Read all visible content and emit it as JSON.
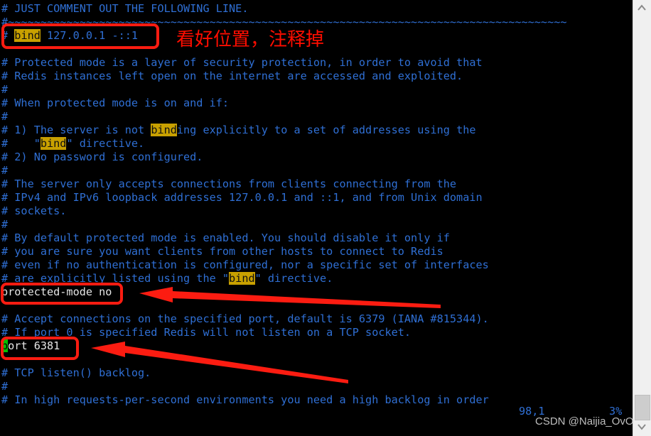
{
  "app": {
    "type": "terminal-text-editor",
    "filename_context": "redis.conf",
    "background_color": "#000000",
    "comment_color": "#2f6fd4",
    "text_color": "#e6e6e6",
    "search_highlight_color": "#c8a000",
    "cursor_color": "#00c000",
    "annotation_color": "#fc1c11"
  },
  "editor": {
    "lines": [
      {
        "id": 0,
        "type": "cmt",
        "segments": [
          {
            "t": "# JUST COMMENT OUT THE FOLLOWING LINE."
          }
        ]
      },
      {
        "id": 1,
        "type": "cmt",
        "segments": [
          {
            "t": "#~~~~~~~~~~~~~~~~~~~~~~~~~~~~~~~~~~~~~~~~~~~~~~~~~~~~~~~~~~~~~~~~~~~~~~~~~~~~~~~~~~~~~~"
          }
        ]
      },
      {
        "id": 2,
        "type": "cmt",
        "segments": [
          {
            "t": "# "
          },
          {
            "t": "bind",
            "hl": true
          },
          {
            "t": " 127.0.0.1 -::1"
          }
        ]
      },
      {
        "id": 3,
        "type": "cmt",
        "segments": [
          {
            "t": ""
          }
        ]
      },
      {
        "id": 4,
        "type": "cmt",
        "segments": [
          {
            "t": "# Protected mode is a layer of security protection, in order to avoid that"
          }
        ]
      },
      {
        "id": 5,
        "type": "cmt",
        "segments": [
          {
            "t": "# Redis instances left open on the internet are accessed and exploited."
          }
        ]
      },
      {
        "id": 6,
        "type": "cmt",
        "segments": [
          {
            "t": "#"
          }
        ]
      },
      {
        "id": 7,
        "type": "cmt",
        "segments": [
          {
            "t": "# When protected mode is on and if:"
          }
        ]
      },
      {
        "id": 8,
        "type": "cmt",
        "segments": [
          {
            "t": "#"
          }
        ]
      },
      {
        "id": 9,
        "type": "cmt",
        "segments": [
          {
            "t": "# 1) The server is not "
          },
          {
            "t": "bind",
            "hl": true
          },
          {
            "t": "ing explicitly to a set of addresses using the"
          }
        ]
      },
      {
        "id": 10,
        "type": "cmt",
        "segments": [
          {
            "t": "#    \""
          },
          {
            "t": "bind",
            "hl": true
          },
          {
            "t": "\" directive."
          }
        ]
      },
      {
        "id": 11,
        "type": "cmt",
        "segments": [
          {
            "t": "# 2) No password is configured."
          }
        ]
      },
      {
        "id": 12,
        "type": "cmt",
        "segments": [
          {
            "t": "#"
          }
        ]
      },
      {
        "id": 13,
        "type": "cmt",
        "segments": [
          {
            "t": "# The server only accepts connections from clients connecting from the"
          }
        ]
      },
      {
        "id": 14,
        "type": "cmt",
        "segments": [
          {
            "t": "# IPv4 and IPv6 loopback addresses 127.0.0.1 and ::1, and from Unix domain"
          }
        ]
      },
      {
        "id": 15,
        "type": "cmt",
        "segments": [
          {
            "t": "# sockets."
          }
        ]
      },
      {
        "id": 16,
        "type": "cmt",
        "segments": [
          {
            "t": "#"
          }
        ]
      },
      {
        "id": 17,
        "type": "cmt",
        "segments": [
          {
            "t": "# By default protected mode is enabled. You should disable it only if"
          }
        ]
      },
      {
        "id": 18,
        "type": "cmt",
        "segments": [
          {
            "t": "# you are sure you want clients from other hosts to connect to Redis"
          }
        ]
      },
      {
        "id": 19,
        "type": "cmt",
        "segments": [
          {
            "t": "# even if no authentication is configured, nor a specific set of interfaces"
          }
        ]
      },
      {
        "id": 20,
        "type": "cmt",
        "segments": [
          {
            "t": "# are explicitly listed using the \""
          },
          {
            "t": "bind",
            "hl": true
          },
          {
            "t": "\" directive."
          }
        ]
      },
      {
        "id": 21,
        "type": "plain",
        "segments": [
          {
            "t": "protected-mode no"
          }
        ]
      },
      {
        "id": 22,
        "type": "cmt",
        "segments": [
          {
            "t": ""
          }
        ]
      },
      {
        "id": 23,
        "type": "cmt",
        "segments": [
          {
            "t": "# Accept connections on the specified port, default is 6379 (IANA #815344)."
          }
        ]
      },
      {
        "id": 24,
        "type": "cmt",
        "segments": [
          {
            "t": "# If port 0 is specified Redis will not listen on a TCP socket."
          }
        ]
      },
      {
        "id": 25,
        "type": "plain",
        "segments": [
          {
            "t": "p",
            "cursor": true
          },
          {
            "t": "ort 6381"
          }
        ]
      },
      {
        "id": 26,
        "type": "cmt",
        "segments": [
          {
            "t": ""
          }
        ]
      },
      {
        "id": 27,
        "type": "cmt",
        "segments": [
          {
            "t": "# TCP listen() backlog."
          }
        ]
      },
      {
        "id": 28,
        "type": "cmt",
        "segments": [
          {
            "t": "#"
          }
        ]
      },
      {
        "id": 29,
        "type": "cmt",
        "segments": [
          {
            "t": "# In high requests-per-second environments you need a high backlog in order"
          }
        ]
      }
    ]
  },
  "status": {
    "position": "98,1",
    "percent": "3%"
  },
  "annotations": {
    "chinese_note": "看好位置，注释掉",
    "boxes": [
      {
        "name": "bind-line-box",
        "label": "# bind 127.0.0.1 -::1"
      },
      {
        "name": "protected-mode-box",
        "label": "protected-mode no"
      },
      {
        "name": "port-box",
        "label": "port 6381"
      }
    ],
    "arrows": [
      {
        "name": "arrow-to-protected-mode",
        "points_to": "protected-mode no"
      },
      {
        "name": "arrow-to-port",
        "points_to": "port 6381"
      }
    ]
  },
  "watermark": {
    "text": "CSDN @Naijia_OvO"
  },
  "scrollbar": {
    "up_arrow": "scroll-up-arrow",
    "down_arrow": "scroll-down-arrow",
    "thumb": "scroll-thumb"
  }
}
